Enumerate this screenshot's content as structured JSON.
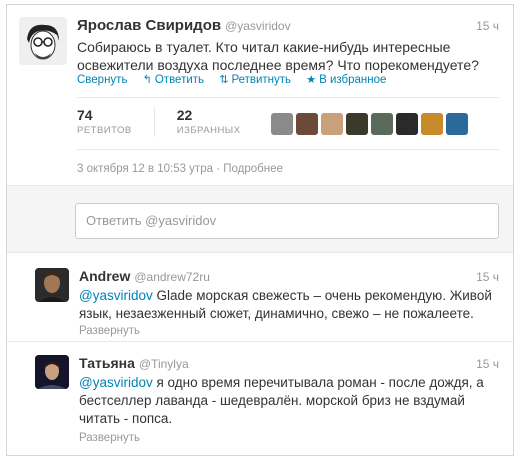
{
  "main_tweet": {
    "author_name": "Ярослав Свиридов",
    "author_handle": "@yasviridov",
    "time": "15 ч",
    "text": "Собираюсь в туалет. Кто читал какие-нибудь интересные освежители воздуха последнее время? Что порекомендуете?",
    "actions": {
      "collapse": "Свернуть",
      "reply": "Ответить",
      "retweet": "Ретвитнуть",
      "favorite": "В избранное"
    },
    "stats": {
      "retweets_count": "74",
      "retweets_label": "РЕТВИТОВ",
      "favorites_count": "22",
      "favorites_label": "ИЗБРАННЫХ"
    },
    "fav_avatar_colors": [
      "#8a8a8a",
      "#6b4a3a",
      "#c9a07a",
      "#3a3a2a",
      "#5a6a5a",
      "#2a2a2a",
      "#c98a2a",
      "#2a6a9a"
    ],
    "datetime": "3 октября 12 в 10:53 утра",
    "details": "Подробнее"
  },
  "reply_box": {
    "placeholder": "Ответить @yasviridov"
  },
  "replies": [
    {
      "author_name": "Andrew",
      "author_handle": "@andrew72ru",
      "time": "15 ч",
      "mention": "@yasviridov",
      "text": " Glade морская свежесть – очень рекомендую. Живой язык, незаезженный сюжет, динамично, свежо – не пожалеете.",
      "expand": "Развернуть"
    },
    {
      "author_name": "Татьяна",
      "author_handle": "@Tinylya",
      "time": "15 ч",
      "mention": "@yasviridov",
      "text": " я одно время перечитывала роман - после дождя, а бестселлер лаванда - шедевралён. морской бриз не вздумай читать - попса.",
      "expand": "Развернуть"
    }
  ],
  "colors": {
    "link": "#0084b4",
    "muted": "#999999",
    "text": "#333333"
  }
}
